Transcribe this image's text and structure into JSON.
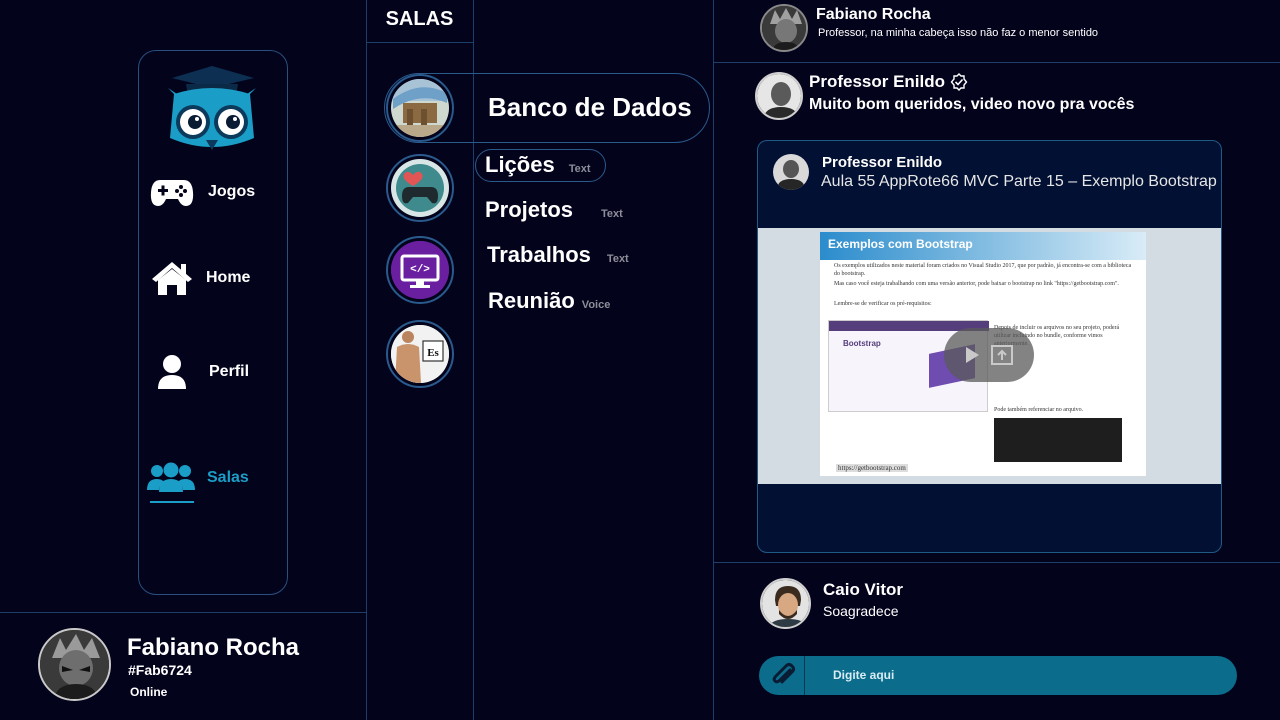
{
  "nav": {
    "items": [
      {
        "label": "Jogos",
        "icon": "gamepad-icon"
      },
      {
        "label": "Home",
        "icon": "home-icon"
      },
      {
        "label": "Perfil",
        "icon": "user-icon"
      },
      {
        "label": "Salas",
        "icon": "users-icon"
      }
    ],
    "active": "Salas"
  },
  "user": {
    "name": "Fabiano Rocha",
    "tag": "#Fab6724",
    "status": "Online"
  },
  "rooms": {
    "title": "SALAS",
    "selected_room": "Banco de Dados",
    "channels": [
      {
        "label": "Lições",
        "type": "Text"
      },
      {
        "label": "Projetos",
        "type": "Text"
      },
      {
        "label": "Trabalhos",
        "type": "Text"
      },
      {
        "label": "Reunião",
        "type": "Voice"
      }
    ]
  },
  "chat": {
    "messages": [
      {
        "author": "Fabiano Rocha",
        "text": "Professor, na minha cabeça isso não faz o menor sentido"
      },
      {
        "author": "Professor Enildo",
        "text": "Muito bom queridos, video novo pra vocês"
      },
      {
        "author": "Caio Vitor",
        "text": "Soagradece"
      }
    ],
    "embed": {
      "channel": "Professor Enildo",
      "title": "Aula 55 AppRote66 MVC Parte 15 – Exemplo Bootstrap",
      "slide_title": "Exemplos com Bootstrap",
      "slide_bullets": [
        "Os exemplos utilizados neste material foram criados no Visual Studio 2017, que por padrão, já encontra-se com a biblioteca do bootstrap.",
        "Mas caso você esteja trabalhando com uma versão anterior, pode baixar o bootstrap no link \"https://getbootstrap.com\".",
        "Lembre-se de verificar os pré-requisitos:"
      ],
      "slide_side_text": "Depois de incluir os arquivos no seu projeto, poderá utilizar incluindo no bundle, conforme vimos anteriormente.",
      "slide_side_text2": "Pode também referenciar no arquivo.",
      "slide_brand": "Bootstrap",
      "slide_link": "https://getbootstrap.com"
    },
    "input_placeholder": "Digite aqui"
  },
  "colors": {
    "background": "#03031c",
    "accent": "#1a9ec7",
    "border": "#27507f",
    "input": "#0b6c8c"
  }
}
